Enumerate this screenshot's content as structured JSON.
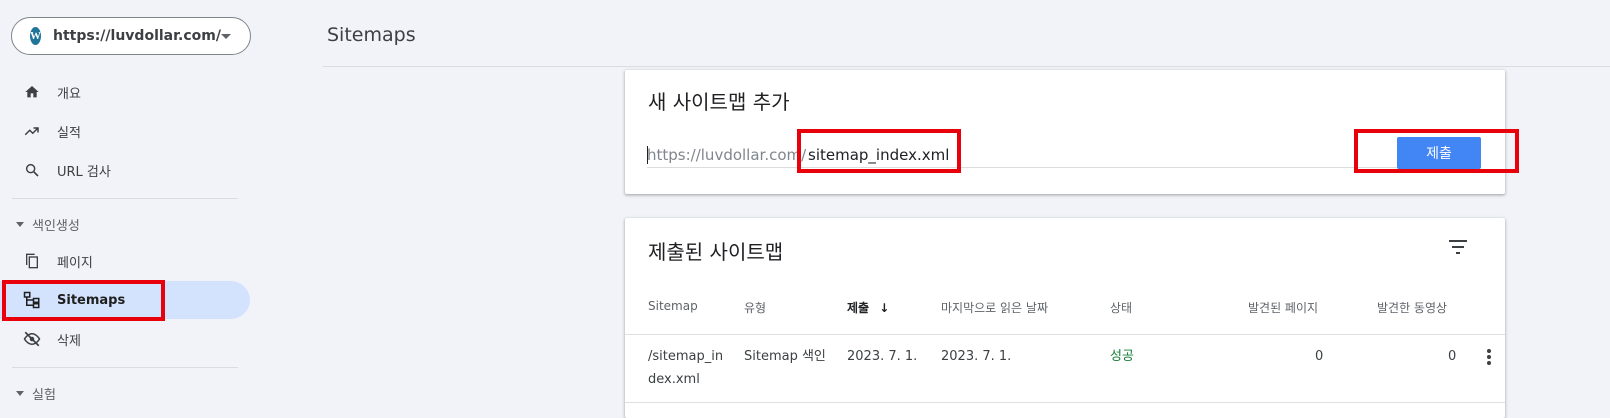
{
  "property": {
    "url": "https://luvdollar.com/",
    "logo_letter": "W"
  },
  "sidebar": {
    "items": [
      {
        "label": "개요",
        "icon": "home-icon"
      },
      {
        "label": "실적",
        "icon": "trending-up-icon"
      },
      {
        "label": "URL 검사",
        "icon": "search-icon"
      }
    ],
    "section_index": {
      "label": "색인생성"
    },
    "index_items": [
      {
        "label": "페이지",
        "icon": "pages-icon"
      },
      {
        "label": "Sitemaps",
        "icon": "sitemap-icon",
        "active": true
      },
      {
        "label": "삭제",
        "icon": "visibility-off-icon"
      }
    ],
    "section_experiment": {
      "label": "실험"
    }
  },
  "header": {
    "title": "Sitemaps"
  },
  "add_sitemap": {
    "title": "새 사이트맵 추가",
    "prefix": "https://luvdollar.com/",
    "input_value": "sitemap_index.xml",
    "submit_label": "제출"
  },
  "submitted": {
    "title": "제출된 사이트맵",
    "columns": [
      "Sitemap",
      "유형",
      "제출",
      "마지막으로 읽은 날짜",
      "상태",
      "발견된 페이지",
      "발견한 동영상"
    ],
    "sort_arrow": "↓",
    "rows": [
      {
        "sitemap_line1": "/sitemap_in",
        "sitemap_line2": "dex.xml",
        "type": "Sitemap 색인",
        "submitted": "2023. 7. 1.",
        "last_read": "2023. 7. 1.",
        "status": "성공",
        "pages": "0",
        "videos": "0"
      }
    ]
  },
  "colors": {
    "accent": "#4285f4",
    "highlight": "#e8000b",
    "success": "#188038",
    "active_bg": "#d3e3fd"
  }
}
